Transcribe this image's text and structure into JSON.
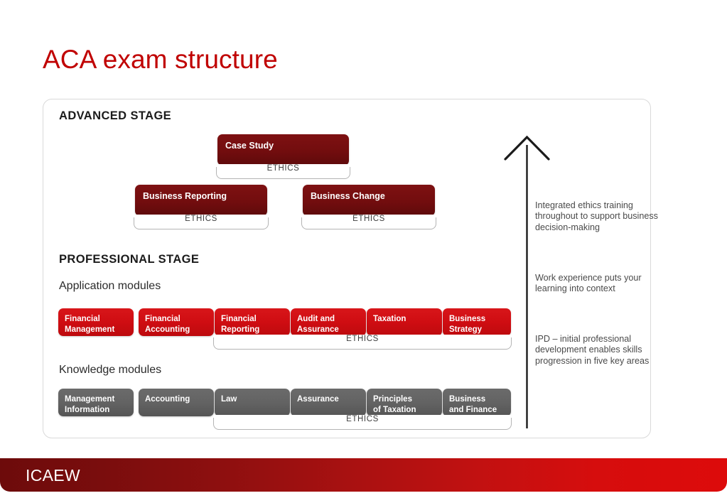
{
  "slide": {
    "title": "ACA exam structure"
  },
  "diagram": {
    "advanced_stage_heading": "ADVANCED STAGE",
    "professional_stage_heading": "PROFESSIONAL STAGE",
    "application_modules_heading": "Application modules",
    "knowledge_modules_heading": "Knowledge modules",
    "ethics_label": "ETHICS",
    "advanced_modules": [
      {
        "line1": "Case Study",
        "line2": ""
      },
      {
        "line1": "Business Reporting",
        "line2": ""
      },
      {
        "line1": "Business Change",
        "line2": ""
      }
    ],
    "application_modules": [
      {
        "line1": "Financial",
        "line2": "Management"
      },
      {
        "line1": "Financial",
        "line2": "Accounting"
      },
      {
        "line1": "Financial",
        "line2": "Reporting"
      },
      {
        "line1": "Audit and",
        "line2": "Assurance"
      },
      {
        "line1": "Taxation",
        "line2": ""
      },
      {
        "line1": "Business",
        "line2": "Strategy"
      }
    ],
    "knowledge_modules": [
      {
        "line1": "Management",
        "line2": "Information"
      },
      {
        "line1": "Accounting",
        "line2": ""
      },
      {
        "line1": "Law",
        "line2": ""
      },
      {
        "line1": "Assurance",
        "line2": ""
      },
      {
        "line1": "Principles",
        "line2": "of Taxation"
      },
      {
        "line1": "Business",
        "line2": "and Finance"
      }
    ],
    "notes": [
      "Integrated ethics training throughout to support business decision-making",
      "Work experience puts your learning into context",
      "IPD – initial professional development enables skills progression in five key areas"
    ]
  },
  "footer": {
    "brand": "ICAEW"
  },
  "colors": {
    "title_red": "#C00000",
    "advanced_dark_red": "#7B0F0F",
    "application_red": "#CF0D12",
    "knowledge_gray": "#636363",
    "card_border": "#D9D9D9",
    "note_text": "#4A4A4A",
    "footer_left": "#6D0B0B",
    "footer_right": "#DD0B0B"
  }
}
